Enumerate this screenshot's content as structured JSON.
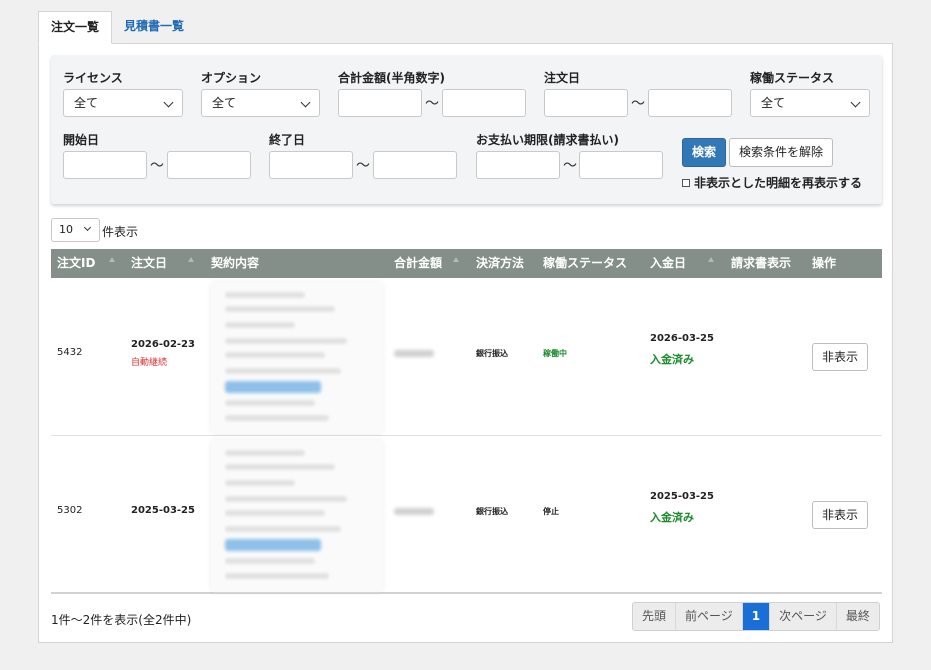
{
  "tabs": [
    {
      "label": "注文一覧"
    },
    {
      "label": "見積書一覧"
    }
  ],
  "filters": {
    "license_label": "ライセンス",
    "license_value": "全て",
    "option_label": "オプション",
    "option_value": "全て",
    "amount_label": "合計金額(半角数字)",
    "order_date_label": "注文日",
    "status_label": "稼働ステータス",
    "status_value": "全て",
    "start_date_label": "開始日",
    "end_date_label": "終了日",
    "payment_due_label": "お支払い期限(請求書払い)",
    "tilde": "〜",
    "search_button": "検索",
    "clear_button": "検索条件を解除",
    "show_hidden_label": "非表示とした明細を再表示する"
  },
  "per_page": {
    "value": "10",
    "label": "件表示"
  },
  "table": {
    "headers": [
      "注文ID",
      "注文日",
      "契約内容",
      "合計金額",
      "決済方法",
      "稼働ステータス",
      "入金日",
      "請求書表示",
      "操作"
    ],
    "rows": [
      {
        "id": "5432",
        "order_date": "2026-02-23",
        "auto_renew": "自動継続",
        "payment_method": "銀行振込",
        "status": "稼働中",
        "paid_date": "2026-03-25",
        "paid_status": "入金済み",
        "action": "非表示"
      },
      {
        "id": "5302",
        "order_date": "2025-03-25",
        "auto_renew": "",
        "payment_method": "銀行振込",
        "status": "停止",
        "paid_date": "2025-03-25",
        "paid_status": "入金済み",
        "action": "非表示"
      }
    ]
  },
  "summary": "1件〜2件を表示(全2件中)",
  "pagination": {
    "first": "先頭",
    "prev": "前ページ",
    "current": "1",
    "next": "次ページ",
    "last": "最終"
  },
  "colors": {
    "accent": "#3277b6",
    "header_bg": "#848f89",
    "active_page": "#1a6ed8",
    "status_active": "#1a8a2a",
    "auto_renew": "#e03030"
  }
}
